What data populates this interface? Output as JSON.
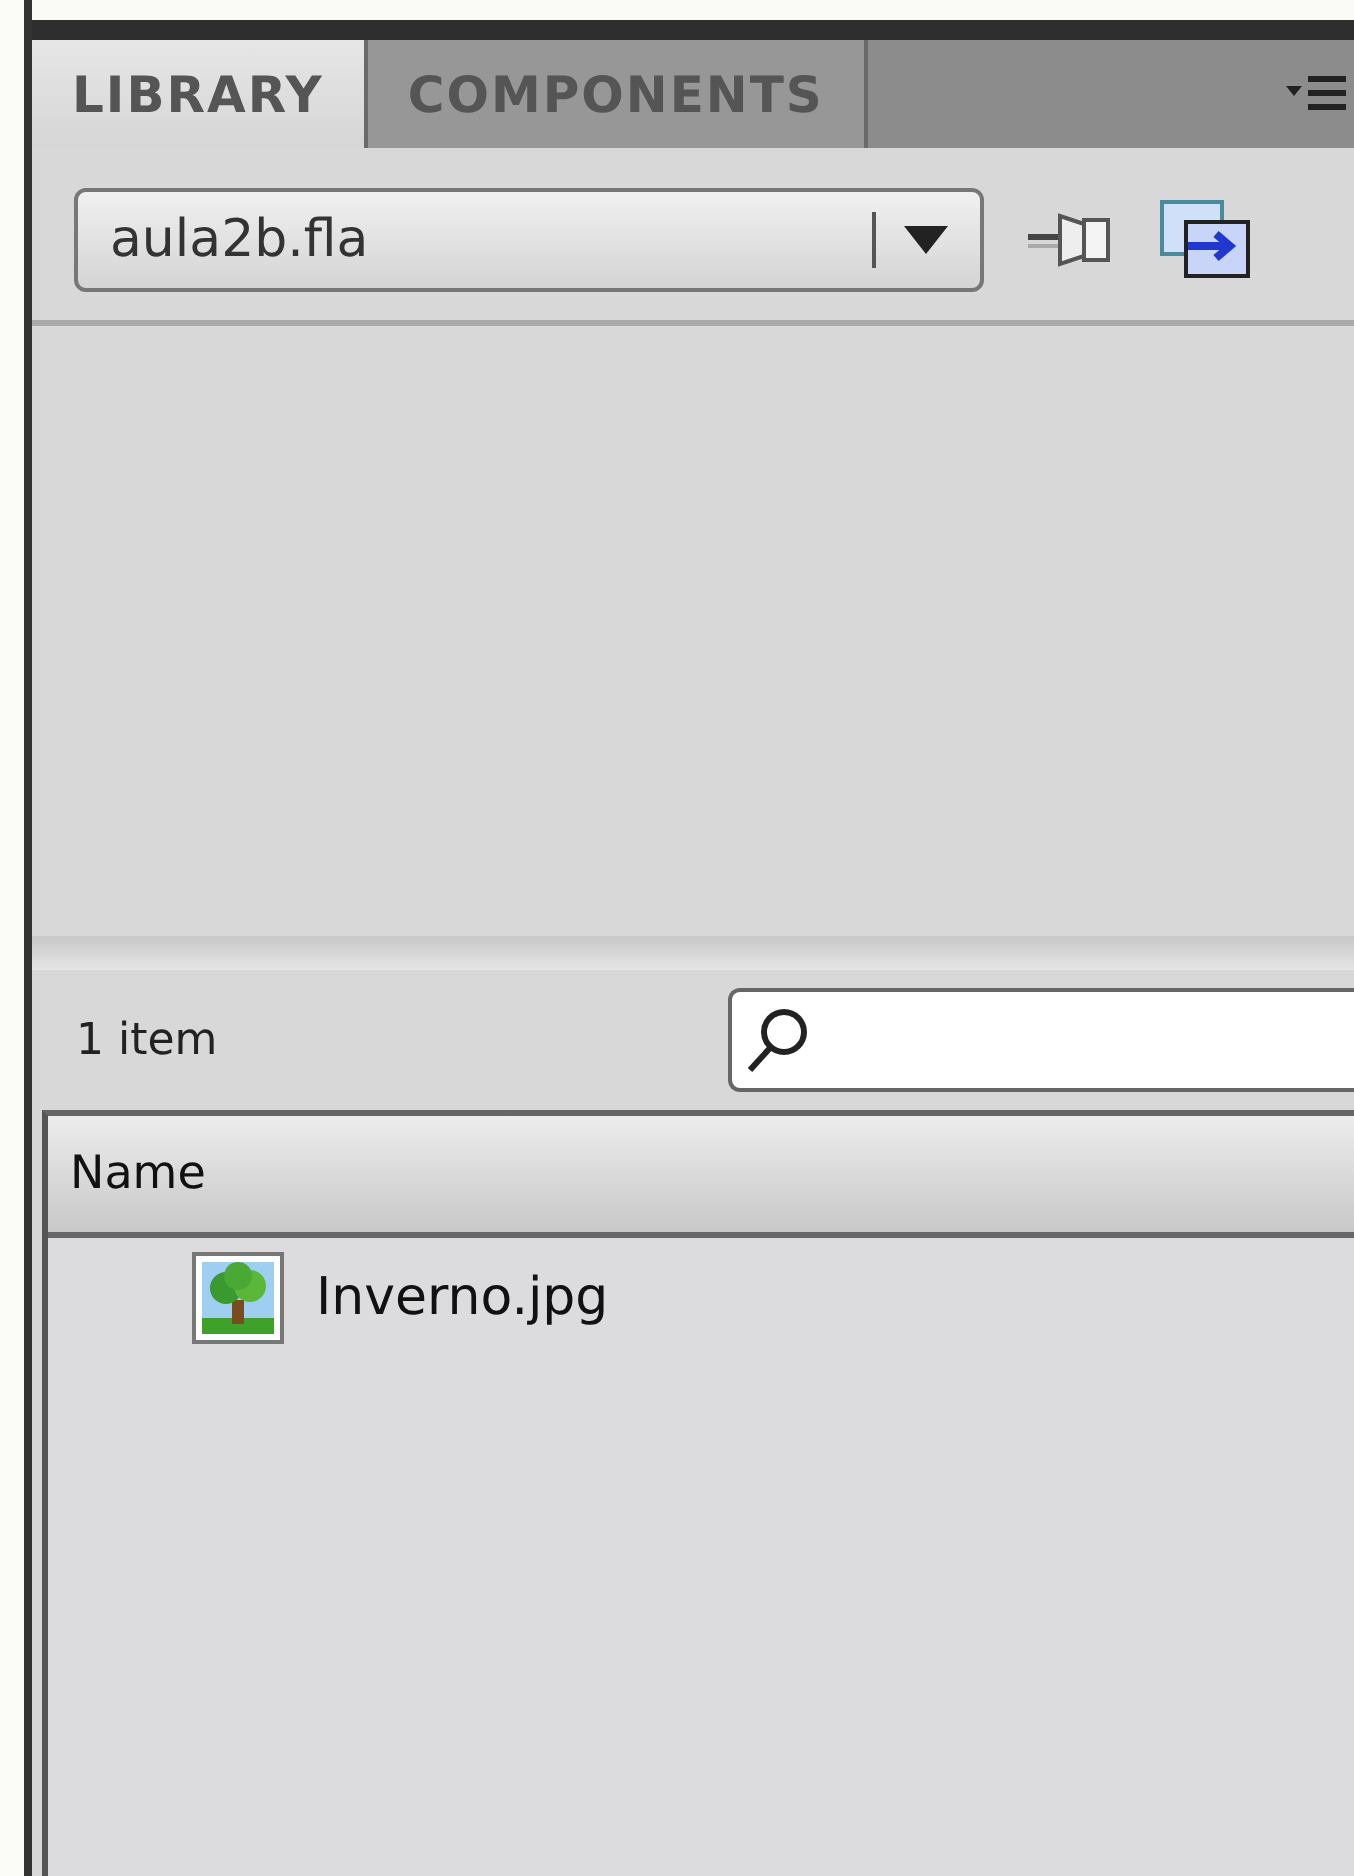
{
  "tabs": [
    {
      "label": "LIBRARY",
      "selected": true
    },
    {
      "label": "COMPONENTS",
      "selected": false
    }
  ],
  "document_select": {
    "value": "aula2b.fla"
  },
  "item_count": "1 item",
  "table": {
    "columns": [
      "Name"
    ],
    "rows": [
      {
        "name": "Inverno.jpg",
        "kind": "bitmap",
        "selected": false
      }
    ]
  }
}
